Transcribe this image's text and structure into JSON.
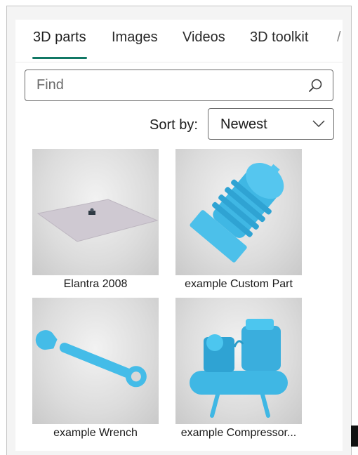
{
  "tabs": [
    {
      "label": "3D parts",
      "active": true
    },
    {
      "label": "Images",
      "active": false
    },
    {
      "label": "Videos",
      "active": false
    },
    {
      "label": "3D toolkit",
      "active": false
    }
  ],
  "search": {
    "placeholder": "Find",
    "value": ""
  },
  "sort": {
    "label": "Sort by:",
    "selected": "Newest"
  },
  "items": [
    {
      "caption": "Elantra 2008",
      "icon": "flat-plate-model"
    },
    {
      "caption": "example Custom Part",
      "icon": "finned-part-model"
    },
    {
      "caption": "example Wrench",
      "icon": "wrench-model"
    },
    {
      "caption": "example Compressor...",
      "icon": "compressor-model"
    }
  ],
  "colors": {
    "accent": "#117865",
    "model": "#4fc3e8"
  }
}
